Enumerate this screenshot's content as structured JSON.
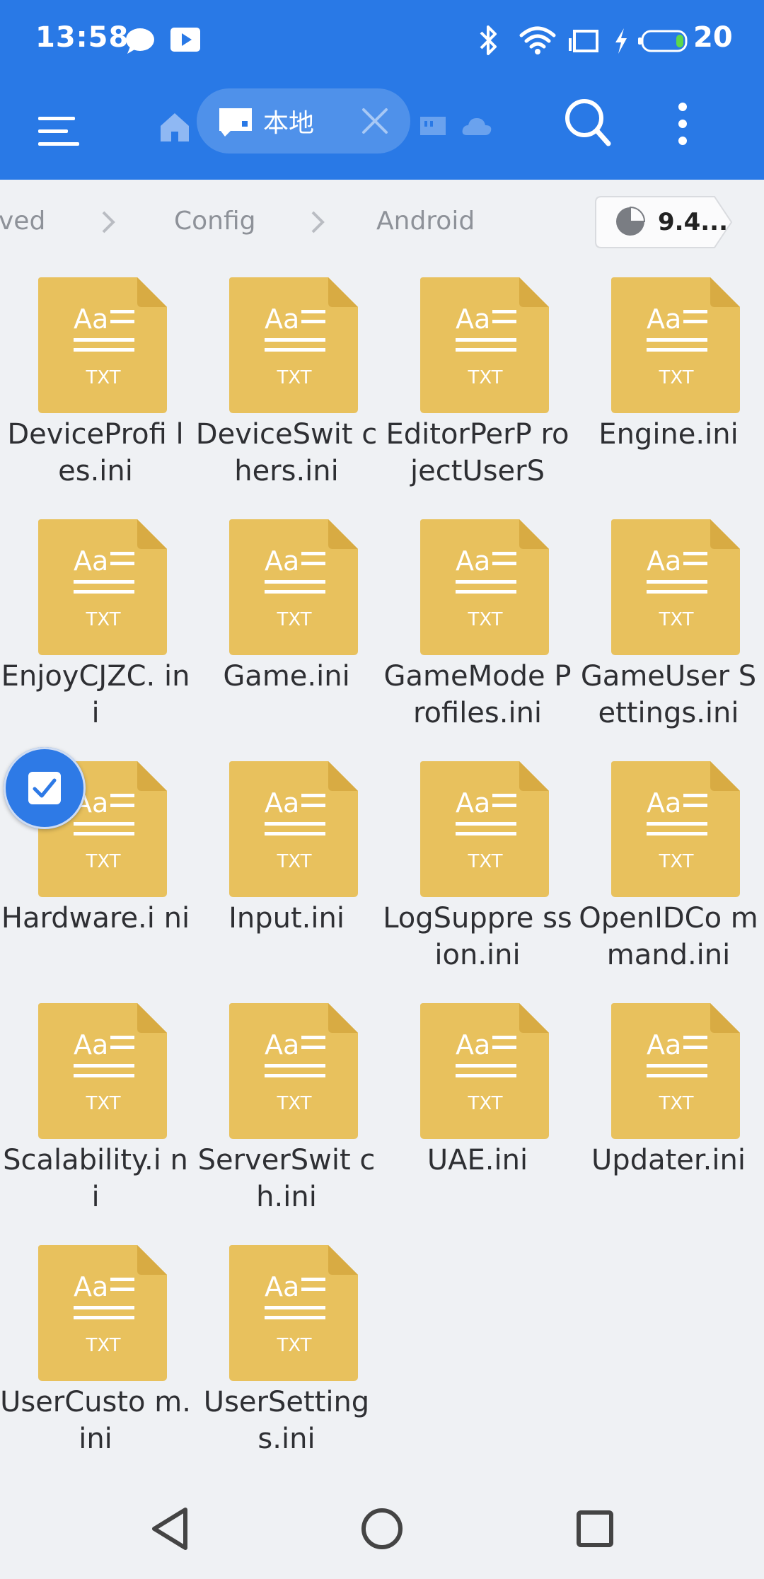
{
  "status_bar": {
    "time": "13:58",
    "battery_level": "20",
    "icons": [
      "chat-bubble-icon",
      "video-play-icon",
      "bluetooth-icon",
      "wifi-icon",
      "screen-cast-icon",
      "charging-icon",
      "battery-icon"
    ]
  },
  "toolbar": {
    "tab_label": "本地",
    "icons": [
      "menu-icon",
      "home-icon",
      "local-drive-icon",
      "close-icon",
      "sd-card-icon",
      "cloud-icon",
      "search-icon",
      "more-vert-icon"
    ]
  },
  "breadcrumb": {
    "items": [
      "ved",
      "Config",
      "Android"
    ],
    "storage_label": "9.4..."
  },
  "files": [
    {
      "name": "DeviceProfiles.ini",
      "display": "DeviceProfi les.ini"
    },
    {
      "name": "DeviceSwitchers.ini",
      "display": "DeviceSwit chers.ini"
    },
    {
      "name": "EditorPerProjectUserS",
      "display": "EditorPerP rojectUserS"
    },
    {
      "name": "Engine.ini",
      "display": "Engine.ini"
    },
    {
      "name": "EnjoyCJZC.ini",
      "display": "EnjoyCJZC. ini"
    },
    {
      "name": "Game.ini",
      "display": "Game.ini"
    },
    {
      "name": "GameModeProfiles.ini",
      "display": "GameMode Profiles.ini"
    },
    {
      "name": "GameUserSettings.ini",
      "display": "GameUser Settings.ini"
    },
    {
      "name": "Hardware.ini",
      "display": "Hardware.i ni"
    },
    {
      "name": "Input.ini",
      "display": "Input.ini"
    },
    {
      "name": "LogSuppression.ini",
      "display": "LogSuppre ssion.ini"
    },
    {
      "name": "OpenIDCommand.ini",
      "display": "OpenIDCo mmand.ini"
    },
    {
      "name": "Scalability.ini",
      "display": "Scalability.i ni"
    },
    {
      "name": "ServerSwitch.ini",
      "display": "ServerSwit ch.ini"
    },
    {
      "name": "UAE.ini",
      "display": "UAE.ini"
    },
    {
      "name": "Updater.ini",
      "display": "Updater.ini"
    },
    {
      "name": "UserCustom.ini",
      "display": "UserCusto m.ini"
    },
    {
      "name": "UserSettings.ini",
      "display": "UserSetting s.ini"
    }
  ],
  "file_icon": {
    "label_top": "Aa",
    "label_bottom": "TXT",
    "color": "#e8c15d",
    "fold_color": "#d8ab43"
  },
  "colors": {
    "accent": "#2979e6",
    "background": "#eff1f4",
    "text": "#2e2f33",
    "muted": "#8e9299"
  },
  "nav_bar": {
    "icons": [
      "back-icon",
      "home-circle-icon",
      "recents-icon"
    ]
  }
}
